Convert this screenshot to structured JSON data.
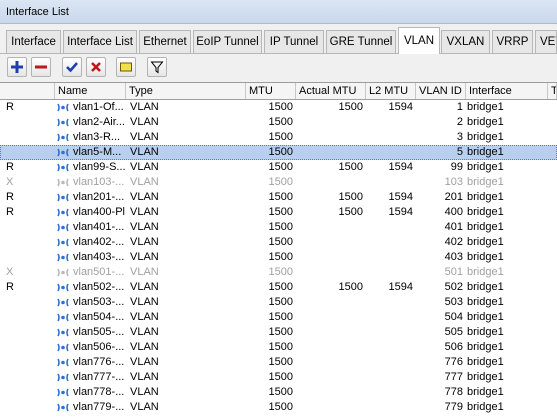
{
  "window": {
    "title": "Interface List"
  },
  "tabs": [
    {
      "label": "Interface",
      "active": false
    },
    {
      "label": "Interface List",
      "active": false
    },
    {
      "label": "Ethernet",
      "active": false
    },
    {
      "label": "EoIP Tunnel",
      "active": false
    },
    {
      "label": "IP Tunnel",
      "active": false
    },
    {
      "label": "GRE Tunnel",
      "active": false
    },
    {
      "label": "VLAN",
      "active": true
    },
    {
      "label": "VXLAN",
      "active": false
    },
    {
      "label": "VRRP",
      "active": false
    },
    {
      "label": "VETH",
      "active": false
    }
  ],
  "toolbar": [
    {
      "name": "add-button",
      "icon": "plus-icon",
      "color": "#1f3fae"
    },
    {
      "name": "remove-button",
      "icon": "minus-icon",
      "color": "#c0151c"
    },
    {
      "name": "enable-button",
      "icon": "check-icon",
      "color": "#1f3fae"
    },
    {
      "name": "disable-button",
      "icon": "x-icon",
      "color": "#c0151c"
    },
    {
      "name": "comment-button",
      "icon": "note-icon",
      "color": "#f2e04a"
    },
    {
      "name": "filter-button",
      "icon": "filter-icon",
      "color": "#000000"
    }
  ],
  "columns": [
    "",
    "Name",
    "Type",
    "MTU",
    "Actual MTU",
    "L2 MTU",
    "VLAN ID",
    "Interface",
    "Tx"
  ],
  "rows": [
    {
      "flag": "R",
      "name": "vlan1-Of...",
      "type": "VLAN",
      "mtu": "1500",
      "actual_mtu": "1500",
      "l2_mtu": "1594",
      "vlan_id": "1",
      "interface": "bridge1",
      "state": "running"
    },
    {
      "flag": "",
      "name": "vlan2-Air...",
      "type": "VLAN",
      "mtu": "1500",
      "actual_mtu": "",
      "l2_mtu": "",
      "vlan_id": "2",
      "interface": "bridge1",
      "state": "normal"
    },
    {
      "flag": "",
      "name": "vlan3-R...",
      "type": "VLAN",
      "mtu": "1500",
      "actual_mtu": "",
      "l2_mtu": "",
      "vlan_id": "3",
      "interface": "bridge1",
      "state": "normal"
    },
    {
      "flag": "",
      "name": "vlan5-M...",
      "type": "VLAN",
      "mtu": "1500",
      "actual_mtu": "",
      "l2_mtu": "",
      "vlan_id": "5",
      "interface": "bridge1",
      "state": "selected"
    },
    {
      "flag": "R",
      "name": "vlan99-S...",
      "type": "VLAN",
      "mtu": "1500",
      "actual_mtu": "1500",
      "l2_mtu": "1594",
      "vlan_id": "99",
      "interface": "bridge1",
      "state": "running"
    },
    {
      "flag": "X",
      "name": "vlan103-...",
      "type": "VLAN",
      "mtu": "1500",
      "actual_mtu": "",
      "l2_mtu": "",
      "vlan_id": "103",
      "interface": "bridge1",
      "state": "disabled"
    },
    {
      "flag": "R",
      "name": "vlan201-...",
      "type": "VLAN",
      "mtu": "1500",
      "actual_mtu": "1500",
      "l2_mtu": "1594",
      "vlan_id": "201",
      "interface": "bridge1",
      "state": "running"
    },
    {
      "flag": "R",
      "name": "vlan400-Pl",
      "type": "VLAN",
      "mtu": "1500",
      "actual_mtu": "1500",
      "l2_mtu": "1594",
      "vlan_id": "400",
      "interface": "bridge1",
      "state": "running"
    },
    {
      "flag": "",
      "name": "vlan401-...",
      "type": "VLAN",
      "mtu": "1500",
      "actual_mtu": "",
      "l2_mtu": "",
      "vlan_id": "401",
      "interface": "bridge1",
      "state": "normal"
    },
    {
      "flag": "",
      "name": "vlan402-...",
      "type": "VLAN",
      "mtu": "1500",
      "actual_mtu": "",
      "l2_mtu": "",
      "vlan_id": "402",
      "interface": "bridge1",
      "state": "normal"
    },
    {
      "flag": "",
      "name": "vlan403-...",
      "type": "VLAN",
      "mtu": "1500",
      "actual_mtu": "",
      "l2_mtu": "",
      "vlan_id": "403",
      "interface": "bridge1",
      "state": "normal"
    },
    {
      "flag": "X",
      "name": "vlan501-...",
      "type": "VLAN",
      "mtu": "1500",
      "actual_mtu": "",
      "l2_mtu": "",
      "vlan_id": "501",
      "interface": "bridge1",
      "state": "disabled"
    },
    {
      "flag": "R",
      "name": "vlan502-...",
      "type": "VLAN",
      "mtu": "1500",
      "actual_mtu": "1500",
      "l2_mtu": "1594",
      "vlan_id": "502",
      "interface": "bridge1",
      "state": "running"
    },
    {
      "flag": "",
      "name": "vlan503-...",
      "type": "VLAN",
      "mtu": "1500",
      "actual_mtu": "",
      "l2_mtu": "",
      "vlan_id": "503",
      "interface": "bridge1",
      "state": "normal"
    },
    {
      "flag": "",
      "name": "vlan504-...",
      "type": "VLAN",
      "mtu": "1500",
      "actual_mtu": "",
      "l2_mtu": "",
      "vlan_id": "504",
      "interface": "bridge1",
      "state": "normal"
    },
    {
      "flag": "",
      "name": "vlan505-...",
      "type": "VLAN",
      "mtu": "1500",
      "actual_mtu": "",
      "l2_mtu": "",
      "vlan_id": "505",
      "interface": "bridge1",
      "state": "normal"
    },
    {
      "flag": "",
      "name": "vlan506-...",
      "type": "VLAN",
      "mtu": "1500",
      "actual_mtu": "",
      "l2_mtu": "",
      "vlan_id": "506",
      "interface": "bridge1",
      "state": "normal"
    },
    {
      "flag": "",
      "name": "vlan776-...",
      "type": "VLAN",
      "mtu": "1500",
      "actual_mtu": "",
      "l2_mtu": "",
      "vlan_id": "776",
      "interface": "bridge1",
      "state": "normal"
    },
    {
      "flag": "",
      "name": "vlan777-...",
      "type": "VLAN",
      "mtu": "1500",
      "actual_mtu": "",
      "l2_mtu": "",
      "vlan_id": "777",
      "interface": "bridge1",
      "state": "normal"
    },
    {
      "flag": "",
      "name": "vlan778-...",
      "type": "VLAN",
      "mtu": "1500",
      "actual_mtu": "",
      "l2_mtu": "",
      "vlan_id": "778",
      "interface": "bridge1",
      "state": "normal"
    },
    {
      "flag": "",
      "name": "vlan779-...",
      "type": "VLAN",
      "mtu": "1500",
      "actual_mtu": "",
      "l2_mtu": "",
      "vlan_id": "779",
      "interface": "bridge1",
      "state": "normal"
    }
  ],
  "colors": {
    "accent": "#b8d0ee",
    "disabled_text": "#a0a0a0",
    "icon_blue": "#2f6fd6"
  }
}
